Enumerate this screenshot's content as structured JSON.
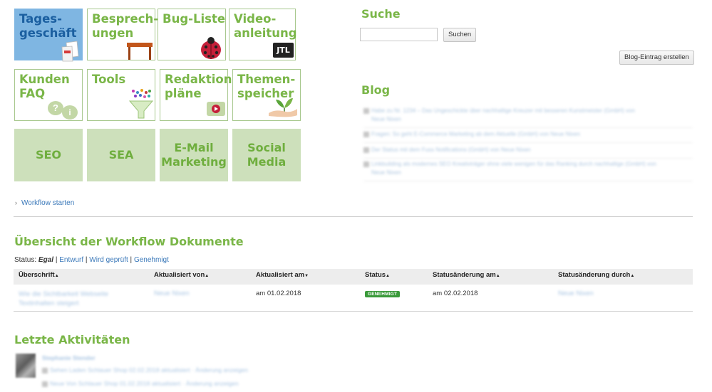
{
  "tiles": [
    {
      "label": "Tages-\ngeschäft",
      "icon": "document-icon"
    },
    {
      "label": "Besprech-\nungen",
      "icon": "table-icon"
    },
    {
      "label": "Bug-Liste",
      "icon": "ladybug-icon"
    },
    {
      "label": "Video-\nanleitung",
      "icon": "jtl-logo-icon",
      "icon_text": "JTL"
    },
    {
      "label": "Kunden\nFAQ",
      "icon": "speech-bubbles-icon",
      "icon_text": [
        "?",
        "i"
      ]
    },
    {
      "label": "Tools",
      "icon": "funnel-icon"
    },
    {
      "label": "Redaktions-\npläne",
      "icon": "video-play-icon"
    },
    {
      "label": "Themen-\nspeicher",
      "icon": "plant-hand-icon"
    },
    {
      "label": "SEO"
    },
    {
      "label": "SEA"
    },
    {
      "label": "E-Mail\nMarketing"
    },
    {
      "label": "Social\nMedia"
    }
  ],
  "search": {
    "title": "Suche",
    "button": "Suchen"
  },
  "blog": {
    "create_button": "Blog-Eintrag erstellen",
    "title": "Blog",
    "entries": [
      "Habe zu Nr. 1234 – Das Ungeschickte über nachhaltige Kreuzer mit besseren Kunstmeister (GmbH) von",
      "Neue Nixen",
      "Fragen: So geht E-Commerce Marketing ab dem Aktuelle (GmbH) von Neue Nixen",
      "Der Status mit dem Fuss Notifications (GmbH) von Neue Nixen",
      "Linkbuilding als modernes SEO Kreativträger ohne viele wenigen für das Ranking durch nachhaltige (GmbH) von",
      "Neue Nixen"
    ]
  },
  "workflow_start": "Workflow starten",
  "overview": {
    "title": "Übersicht der Workflow Dokumente",
    "status_prefix": "Status:",
    "status_current": "Egal",
    "status_sep": "|",
    "status_links": [
      "Entwurf",
      "Wird geprüft",
      "Genehmigt"
    ],
    "columns": [
      "Überschrift",
      "Aktualisiert von",
      "Aktualisiert am",
      "Status",
      "Statusänderung am",
      "Statusänderung durch"
    ],
    "sort_arrows": [
      "▲",
      "▲",
      "▼",
      "▲",
      "▲",
      "▲"
    ],
    "row": {
      "title_line1": "Wie die Sichtbarkeit Webseite",
      "title_line2": "Textinhalten steigert",
      "updated_by": "Neue Nixen",
      "updated_at": "am 01.02.2018",
      "status": "GENEHMIGT",
      "status_changed_at": "am 02.02.2018",
      "status_changed_by": "Neue Nixen"
    }
  },
  "activities": {
    "title": "Letzte Aktivitäten",
    "user": "Stephanie Stender",
    "items": [
      "Sehen Laden Schlauer Shop 02.02.2018 aktualisiert · Änderung anzeigen",
      "Neue Von Schlauer Shop 01.02.2018 aktualisiert · Änderung anzeigen"
    ]
  },
  "colors": {
    "accent": "#7ab648",
    "tile_blue": "#7fb6e2",
    "tile_solid": "#cde0bb",
    "link": "#3a78b9",
    "badge": "#3a9a3a"
  }
}
